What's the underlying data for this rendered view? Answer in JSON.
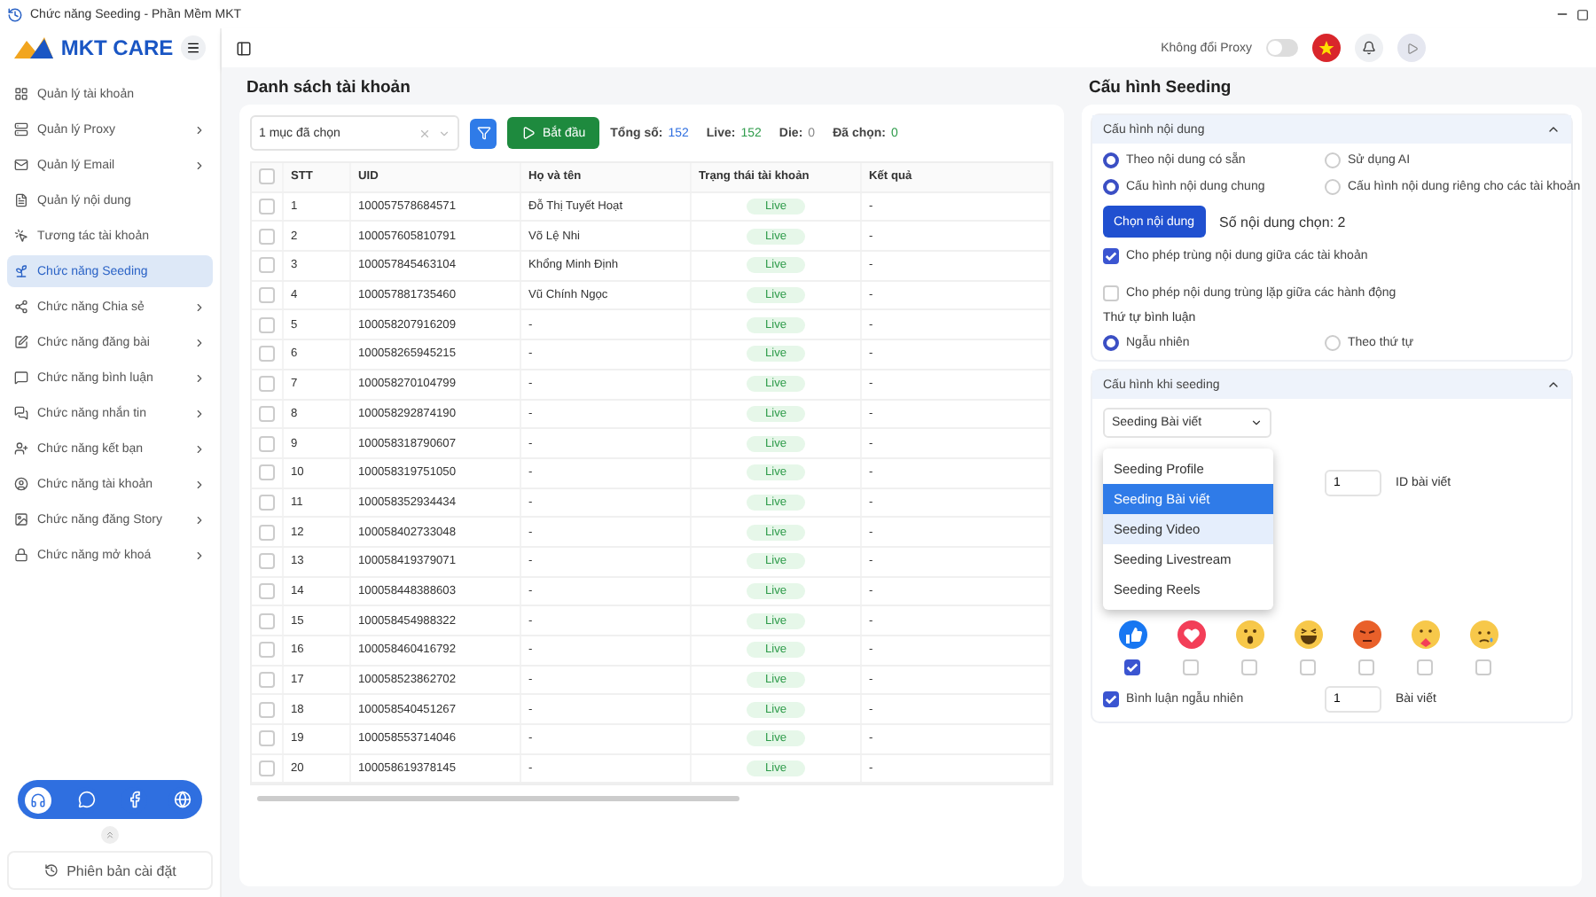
{
  "window": {
    "title": "Chức năng Seeding - Phần Mềm MKT"
  },
  "sidebar": {
    "brand": "MKT CARE",
    "items": [
      {
        "label": "Quản lý tài khoản",
        "selected": false,
        "expandable": false
      },
      {
        "label": "Quản lý Proxy",
        "selected": false,
        "expandable": true
      },
      {
        "label": "Quản lý Email",
        "selected": false,
        "expandable": true
      },
      {
        "label": "Quản lý nội dung",
        "selected": false,
        "expandable": false
      },
      {
        "label": "Tương tác tài khoản",
        "selected": false,
        "expandable": false
      },
      {
        "label": "Chức năng Seeding",
        "selected": true,
        "expandable": false
      },
      {
        "label": "Chức năng Chia sẻ",
        "selected": false,
        "expandable": true
      },
      {
        "label": "Chức năng đăng bài",
        "selected": false,
        "expandable": true
      },
      {
        "label": "Chức năng bình luận",
        "selected": false,
        "expandable": true
      },
      {
        "label": "Chức năng nhắn tin",
        "selected": false,
        "expandable": true
      },
      {
        "label": "Chức năng kết bạn",
        "selected": false,
        "expandable": true
      },
      {
        "label": "Chức năng tài khoản",
        "selected": false,
        "expandable": true
      },
      {
        "label": "Chức năng đăng Story",
        "selected": false,
        "expandable": true
      },
      {
        "label": "Chức năng mở khoá",
        "selected": false,
        "expandable": true
      }
    ],
    "version_label": "Phiên bản cài đặt"
  },
  "topbar": {
    "proxy_label": "Không đổi Proxy",
    "proxy_on": false
  },
  "accounts": {
    "title": "Danh sách tài khoản",
    "filter_value": "1 mục đã chọn",
    "start_button": "Bắt đầu",
    "stats": [
      {
        "label": "Tổng số:",
        "value": "152",
        "kind": "total"
      },
      {
        "label": "Live:",
        "value": "152",
        "kind": "live"
      },
      {
        "label": "Die:",
        "value": "0",
        "kind": "die"
      },
      {
        "label": "Đã chọn:",
        "value": "0",
        "kind": "picked"
      }
    ],
    "header_checked": false,
    "columns": [
      "STT",
      "UID",
      "Họ và tên",
      "Trạng thái tài khoản",
      "Kết quả"
    ],
    "rows": [
      {
        "stt": "1",
        "uid": "100057578684571",
        "name": "Đỗ Thị Tuyết Hoạt",
        "status": "Live",
        "result": "-",
        "checked": false
      },
      {
        "stt": "2",
        "uid": "100057605810791",
        "name": "Võ Lệ Nhi",
        "status": "Live",
        "result": "-",
        "checked": false
      },
      {
        "stt": "3",
        "uid": "100057845463104",
        "name": "Khổng Minh Định",
        "status": "Live",
        "result": "-",
        "checked": false
      },
      {
        "stt": "4",
        "uid": "100057881735460",
        "name": "Vũ Chính Ngọc",
        "status": "Live",
        "result": "-",
        "checked": false
      },
      {
        "stt": "5",
        "uid": "100058207916209",
        "name": "-",
        "status": "Live",
        "result": "-",
        "checked": false
      },
      {
        "stt": "6",
        "uid": "100058265945215",
        "name": "-",
        "status": "Live",
        "result": "-",
        "checked": false
      },
      {
        "stt": "7",
        "uid": "100058270104799",
        "name": "-",
        "status": "Live",
        "result": "-",
        "checked": false
      },
      {
        "stt": "8",
        "uid": "100058292874190",
        "name": "-",
        "status": "Live",
        "result": "-",
        "checked": false
      },
      {
        "stt": "9",
        "uid": "100058318790607",
        "name": "-",
        "status": "Live",
        "result": "-",
        "checked": false
      },
      {
        "stt": "10",
        "uid": "100058319751050",
        "name": "-",
        "status": "Live",
        "result": "-",
        "checked": false
      },
      {
        "stt": "11",
        "uid": "100058352934434",
        "name": "-",
        "status": "Live",
        "result": "-",
        "checked": false
      },
      {
        "stt": "12",
        "uid": "100058402733048",
        "name": "-",
        "status": "Live",
        "result": "-",
        "checked": false
      },
      {
        "stt": "13",
        "uid": "100058419379071",
        "name": "-",
        "status": "Live",
        "result": "-",
        "checked": false
      },
      {
        "stt": "14",
        "uid": "100058448388603",
        "name": "-",
        "status": "Live",
        "result": "-",
        "checked": false
      },
      {
        "stt": "15",
        "uid": "100058454988322",
        "name": "-",
        "status": "Live",
        "result": "-",
        "checked": false
      },
      {
        "stt": "16",
        "uid": "100058460416792",
        "name": "-",
        "status": "Live",
        "result": "-",
        "checked": false
      },
      {
        "stt": "17",
        "uid": "100058523862702",
        "name": "-",
        "status": "Live",
        "result": "-",
        "checked": false
      },
      {
        "stt": "18",
        "uid": "100058540451267",
        "name": "-",
        "status": "Live",
        "result": "-",
        "checked": false
      },
      {
        "stt": "19",
        "uid": "100058553714046",
        "name": "-",
        "status": "Live",
        "result": "-",
        "checked": false
      },
      {
        "stt": "20",
        "uid": "100058619378145",
        "name": "-",
        "status": "Live",
        "result": "-",
        "checked": false
      }
    ]
  },
  "seeding": {
    "title": "Cấu hình Seeding",
    "content_section": {
      "title": "Cấu hình nội dung",
      "expanded": true,
      "source_options": [
        {
          "label": "Theo nội dung có sẵn",
          "selected": true
        },
        {
          "label": "Sử dụng AI",
          "selected": false
        }
      ],
      "scope_options": [
        {
          "label": "Cấu hình nội dung chung",
          "selected": true
        },
        {
          "label": "Cấu hình nội dung riêng cho các tài khoản",
          "selected": false
        }
      ],
      "choose_button": "Chọn nội dung",
      "chosen_count": "Số nội dung chọn: 2",
      "checks": [
        {
          "label": "Cho phép trùng nội dung giữa các tài khoản",
          "checked": true
        },
        {
          "label": "Cho phép nội dung trùng lặp giữa các hành động",
          "checked": false
        }
      ],
      "order_label": "Thứ tự bình luận",
      "order_options": [
        {
          "label": "Ngẫu nhiên",
          "selected": true
        },
        {
          "label": "Theo thứ tự",
          "selected": false
        }
      ]
    },
    "seeding_section": {
      "title": "Cấu hình khi seeding",
      "expanded": true,
      "type_select": {
        "value": "Seeding Bài viết",
        "open": true,
        "options": [
          {
            "label": "Seeding Profile",
            "selected": false,
            "hovered": false
          },
          {
            "label": "Seeding Bài viết",
            "selected": true,
            "hovered": false
          },
          {
            "label": "Seeding Video",
            "selected": false,
            "hovered": true
          },
          {
            "label": "Seeding Livestream",
            "selected": false,
            "hovered": false
          },
          {
            "label": "Seeding Reels",
            "selected": false,
            "hovered": false
          }
        ]
      },
      "post_id": {
        "value": "1",
        "label": "ID bài viết"
      },
      "reactions": [
        {
          "kind": "like",
          "checked": true
        },
        {
          "kind": "love",
          "checked": false
        },
        {
          "kind": "wow",
          "checked": false
        },
        {
          "kind": "haha",
          "checked": false
        },
        {
          "kind": "angry",
          "checked": false
        },
        {
          "kind": "care",
          "checked": false
        },
        {
          "kind": "sad",
          "checked": false
        }
      ],
      "random_comment": {
        "label": "Bình luận ngẫu nhiên",
        "checked": true,
        "value": "1",
        "unit": "Bài viết"
      }
    }
  }
}
